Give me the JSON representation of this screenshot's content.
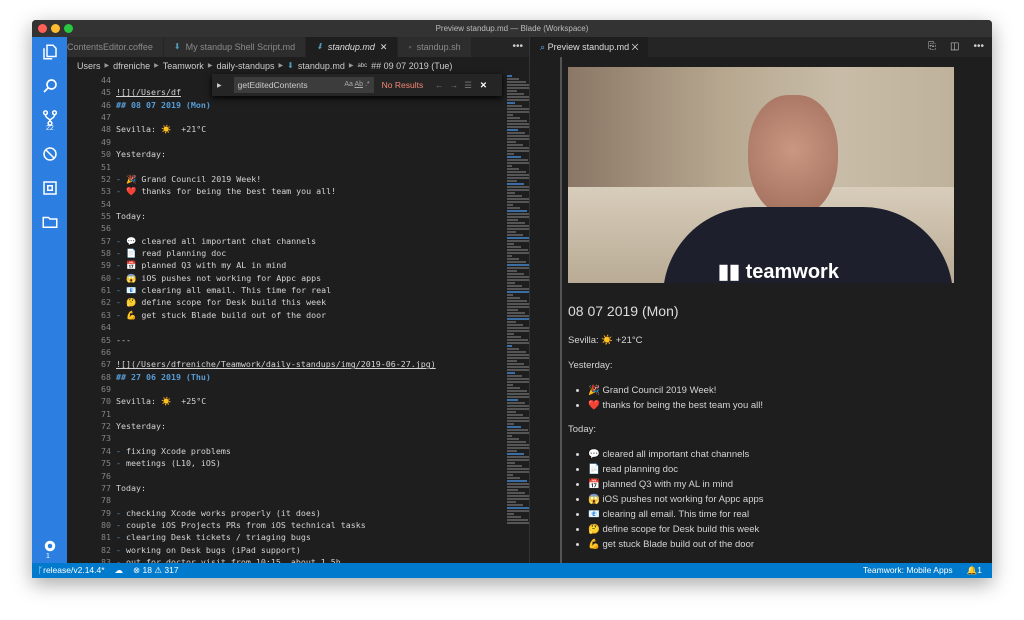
{
  "window": {
    "title": "Preview standup.md — Blade (Workspace)"
  },
  "activity_bar": {
    "items": [
      "explorer-icon",
      "search-icon",
      "source-control-icon",
      "debug-icon",
      "extensions-icon",
      "folder-icon"
    ],
    "scm_badge": "22",
    "settings_badge": "1"
  },
  "editor": {
    "tabs": [
      {
        "label": "ContentsEditor.coffee"
      },
      {
        "label": "My standup Shell Script.md"
      },
      {
        "label": "standup.md",
        "active": true
      },
      {
        "label": "standup.sh"
      }
    ],
    "more": "•••",
    "breadcrumb": [
      "Users",
      "dfreniche",
      "Teamwork",
      "daily-standups",
      "standup.md",
      "## 09 07 2019 (Tue)"
    ],
    "find": {
      "value": "getEditedContents",
      "opt_case": "Aa",
      "opt_word": "Ab",
      "opt_regex": ".*",
      "result": "No Results"
    },
    "lines": [
      {
        "n": "44",
        "t": "",
        "k": ""
      },
      {
        "n": "45",
        "t": "![](/Users/df",
        "k": "link"
      },
      {
        "n": "46",
        "t": "## 08 07 2019 (Mon)",
        "k": "h"
      },
      {
        "n": "47",
        "t": "",
        "k": ""
      },
      {
        "n": "48",
        "t": "Sevilla: ☀️  +21°C",
        "k": ""
      },
      {
        "n": "49",
        "t": "",
        "k": ""
      },
      {
        "n": "50",
        "t": "Yesterday:",
        "k": ""
      },
      {
        "n": "51",
        "t": "",
        "k": ""
      },
      {
        "n": "52",
        "t": "🎉 Grand Council 2019 Week!",
        "k": "li"
      },
      {
        "n": "53",
        "t": "❤️ thanks for being the best team you all!",
        "k": "li"
      },
      {
        "n": "54",
        "t": "",
        "k": ""
      },
      {
        "n": "55",
        "t": "Today:",
        "k": ""
      },
      {
        "n": "56",
        "t": "",
        "k": ""
      },
      {
        "n": "57",
        "t": "💬 cleared all important chat channels",
        "k": "li"
      },
      {
        "n": "58",
        "t": "📄 read planning doc",
        "k": "li"
      },
      {
        "n": "59",
        "t": "📅 planned Q3 with my AL in mind",
        "k": "li"
      },
      {
        "n": "60",
        "t": "😱 iOS pushes not working for Appc apps",
        "k": "li"
      },
      {
        "n": "61",
        "t": "📧 clearing all email. This time for real",
        "k": "li"
      },
      {
        "n": "62",
        "t": "🤔 define scope for Desk build this week",
        "k": "li"
      },
      {
        "n": "63",
        "t": "💪 get stuck Blade build out of the door",
        "k": "li"
      },
      {
        "n": "64",
        "t": "",
        "k": ""
      },
      {
        "n": "65",
        "t": "---",
        "k": ""
      },
      {
        "n": "66",
        "t": "",
        "k": ""
      },
      {
        "n": "67",
        "t": "![](/Users/dfreniche/Teamwork/daily-standups/img/2019-06-27.jpg)",
        "k": "link"
      },
      {
        "n": "68",
        "t": "## 27 06 2019 (Thu)",
        "k": "h"
      },
      {
        "n": "69",
        "t": "",
        "k": ""
      },
      {
        "n": "70",
        "t": "Sevilla: ☀️  +25°C",
        "k": ""
      },
      {
        "n": "71",
        "t": "",
        "k": ""
      },
      {
        "n": "72",
        "t": "Yesterday:",
        "k": ""
      },
      {
        "n": "73",
        "t": "",
        "k": ""
      },
      {
        "n": "74",
        "t": "fixing Xcode problems",
        "k": "li"
      },
      {
        "n": "75",
        "t": "meetings (L10, iOS)",
        "k": "li"
      },
      {
        "n": "76",
        "t": "",
        "k": ""
      },
      {
        "n": "77",
        "t": "Today:",
        "k": ""
      },
      {
        "n": "78",
        "t": "",
        "k": ""
      },
      {
        "n": "79",
        "t": "checking Xcode works properly (it does)",
        "k": "li"
      },
      {
        "n": "80",
        "t": "couple iOS Projects PRs from iOS technical tasks",
        "k": "li"
      },
      {
        "n": "81",
        "t": "clearing Desk tickets / triaging bugs",
        "k": "li"
      },
      {
        "n": "82",
        "t": "working on Desk bugs (iPad support)",
        "k": "li"
      },
      {
        "n": "83",
        "t": "out for doctor visit from 10:15, about 1.5h",
        "k": "li"
      }
    ]
  },
  "preview": {
    "tab": "Preview standup.md",
    "image_logo": "teamwork.com",
    "heading": "08 07 2019 (Mon)",
    "weather": "Sevilla: ☀️ +21°C",
    "yesterday_label": "Yesterday:",
    "yesterday": [
      "🎉 Grand Council 2019 Week!",
      "❤️ thanks for being the best team you all!"
    ],
    "today_label": "Today:",
    "today": [
      "💬 cleared all important chat channels",
      "📄 read planning doc",
      "📅 planned Q3 with my AL in mind",
      "😱 iOS pushes not working for Appc apps",
      "📧 clearing all email. This time for real",
      "🤔 define scope for Desk build this week",
      "💪 get stuck Blade build out of the door"
    ]
  },
  "status": {
    "branch": "release/v2.14.4*",
    "errors": "18",
    "warnings": "317",
    "workspace": "Teamwork: Mobile Apps",
    "notifications": "1",
    "color": "#007acc"
  }
}
